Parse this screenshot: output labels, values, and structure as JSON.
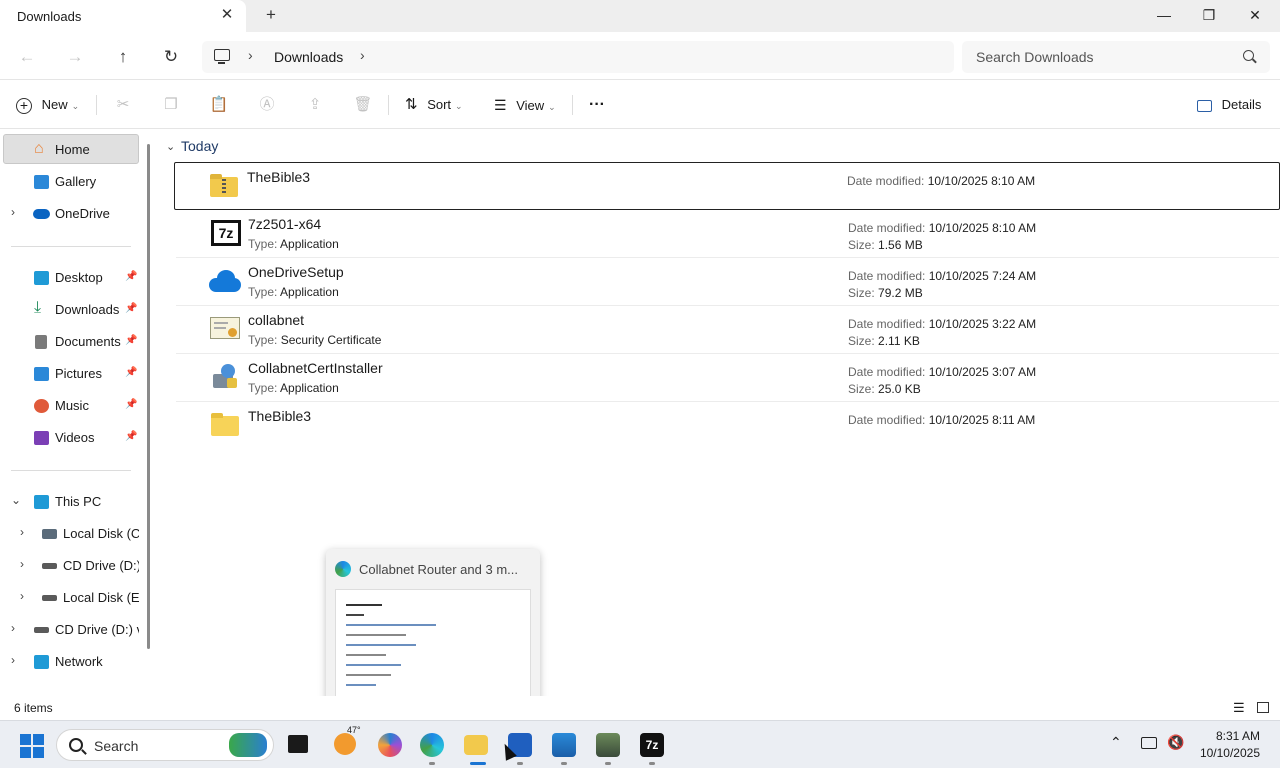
{
  "window": {
    "tab_title": "Downloads",
    "tab_close": "✕",
    "new_tab": "+",
    "minimize": "—",
    "maximize": "❐",
    "close": "✕"
  },
  "address_bar": {
    "back": "←",
    "forward": "→",
    "up": "↑",
    "refresh": "↻",
    "path": [
      "Downloads"
    ],
    "separator": "›",
    "search_placeholder": "Search Downloads"
  },
  "command_bar": {
    "new_label": "New",
    "sort_label": "Sort",
    "view_label": "View",
    "more": "···",
    "details_label": "Details",
    "caret": "⌄"
  },
  "sidebar": {
    "items": [
      {
        "label": "Home",
        "icon": "home-icon",
        "color": "#e8833a"
      },
      {
        "label": "Gallery",
        "icon": "gallery-icon",
        "color": "#2b88d8"
      },
      {
        "label": "OneDrive",
        "icon": "onedrive-icon",
        "color": "#0a64c2"
      },
      {
        "label": "Desktop",
        "icon": "desktop-icon",
        "color": "#1f9ad6"
      },
      {
        "label": "Downloads",
        "icon": "downloads-icon",
        "color": "#1e8a5a"
      },
      {
        "label": "Documents",
        "icon": "documents-icon",
        "color": "#7a7a7a"
      },
      {
        "label": "Pictures",
        "icon": "pictures-icon",
        "color": "#2b88d8"
      },
      {
        "label": "Music",
        "icon": "music-icon",
        "color": "#e05a3a"
      },
      {
        "label": "Videos",
        "icon": "videos-icon",
        "color": "#7b3fb5"
      },
      {
        "label": "This PC",
        "icon": "this-pc-icon",
        "color": "#1f9ad6"
      },
      {
        "label": "Local Disk (C:)",
        "icon": "disk-icon",
        "color": "#5a6b7a"
      },
      {
        "label": "CD Drive (D:) v",
        "icon": "cd-drive-icon",
        "color": "#5a5a5a"
      },
      {
        "label": "Local Disk (E:)",
        "icon": "disk-icon",
        "color": "#5a5a5a"
      },
      {
        "label": "CD Drive (D:) vir",
        "icon": "cd-drive-icon",
        "color": "#5a5a5a"
      },
      {
        "label": "Network",
        "icon": "network-icon",
        "color": "#1f9ad6"
      }
    ],
    "pin": "📌",
    "expand": "›",
    "collapse": "⌄"
  },
  "content": {
    "group": "Today",
    "date_key": "Date modified:",
    "size_key": "Size:",
    "type_key": "Type:",
    "files": [
      {
        "name": "TheBible3",
        "type": "",
        "date": "10/10/2025 8:10 AM",
        "size": "",
        "icon": "zip-folder-icon"
      },
      {
        "name": "7z2501-x64",
        "type": "Application",
        "date": "10/10/2025 8:10 AM",
        "size": "1.56 MB",
        "icon": "7zip-icon"
      },
      {
        "name": "OneDriveSetup",
        "type": "Application",
        "date": "10/10/2025 7:24 AM",
        "size": "79.2 MB",
        "icon": "onedrive-icon"
      },
      {
        "name": "collabnet",
        "type": "Security Certificate",
        "date": "10/10/2025 3:22 AM",
        "size": "2.11 KB",
        "icon": "certificate-icon"
      },
      {
        "name": "CollabnetCertInstaller",
        "type": "Application",
        "date": "10/10/2025 3:07 AM",
        "size": "25.0 KB",
        "icon": "installer-icon"
      },
      {
        "name": "TheBible3",
        "type": "",
        "date": "10/10/2025 8:11 AM",
        "size": "",
        "icon": "folder-icon"
      }
    ]
  },
  "status": {
    "item_count": "6 items"
  },
  "thumbnail": {
    "title": "Collabnet Router and 3 m..."
  },
  "taskbar": {
    "search_label": "Search",
    "weather_temp": "47°",
    "time": "8:31 AM",
    "date": "10/10/2025"
  }
}
